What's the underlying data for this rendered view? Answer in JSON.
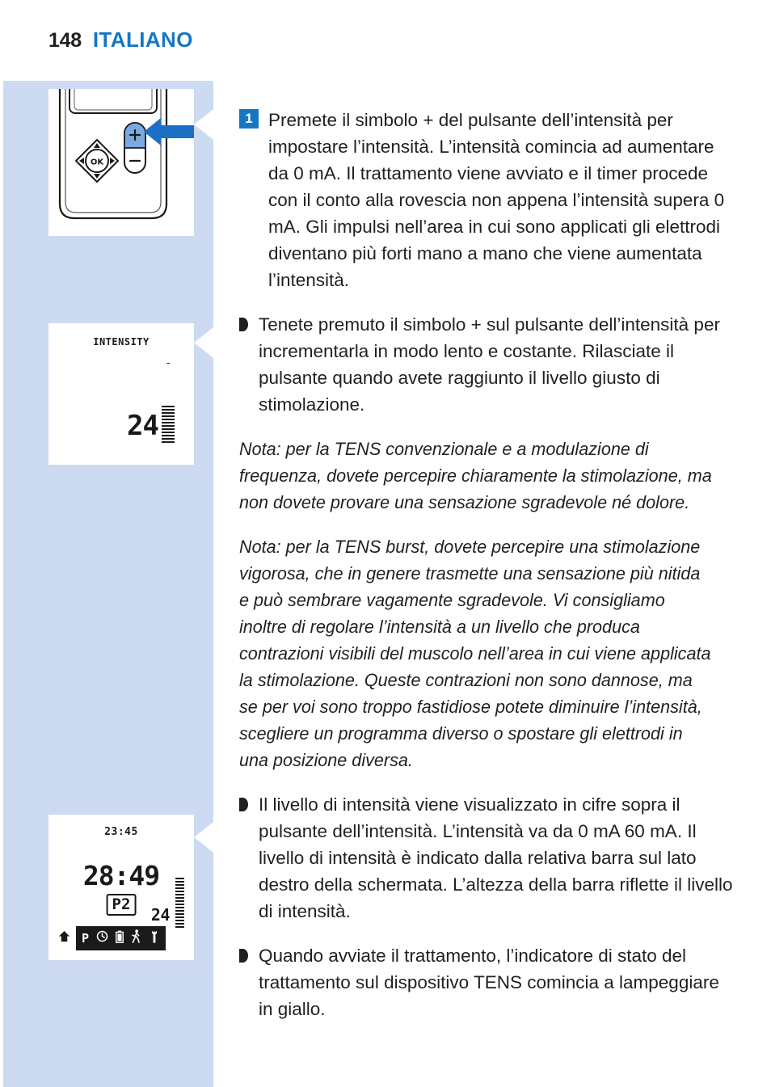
{
  "header": {
    "page_number": "148",
    "chapter": "ITALIANO"
  },
  "colors": {
    "accent_blue": "#1577c4",
    "panel_blue": "#ccdaf2",
    "text": "#231f20"
  },
  "illustrations": {
    "device": {
      "caption_ref": "1",
      "plus_label": "+",
      "minus_label": "−",
      "ok_label": "OK"
    },
    "lcd_intensity": {
      "label": "INTENSITY",
      "minus_mark": "-",
      "value": "24"
    },
    "lcd_treatment": {
      "clock": "23:45",
      "timer": "28:49",
      "program": "P2",
      "intensity": "24",
      "icons": [
        "home-icon",
        "program-icon",
        "clock-icon",
        "battery-icon",
        "walking-icon",
        "wrench-icon"
      ],
      "program_icon_label": "P"
    }
  },
  "content": {
    "step1": {
      "number": "1",
      "text": "Premete il simbolo + del pulsante dell’intensità per impostare l’intensità. L’intensità comincia ad aumentare da 0 mA. Il trattamento viene avviato e il timer procede con il conto alla rovescia non appena l’intensità supera 0 mA. Gli impulsi nell’area in cui sono applicati gli elettrodi diventano più forti mano a mano che viene aumentata l’intensità."
    },
    "bullet1": "Tenete premuto il simbolo + sul pulsante dell’intensità per incrementarla in modo lento e costante. Rilasciate il pulsante quando avete raggiunto il livello giusto di stimolazione.",
    "note1": "Nota: per la TENS convenzionale e a modulazione di frequenza, dovete percepire chiaramente la stimolazione, ma non dovete provare una sensazione sgradevole né dolore.",
    "note2": "Nota: per la TENS burst, dovete percepire una stimolazione vigorosa, che in genere trasmette una sensazione più nitida e può sembrare vagamente sgradevole. Vi consigliamo inoltre di regolare l’intensità a un livello che produca contrazioni visibili del muscolo nell’area in cui viene applicata la stimolazione. Queste contrazioni non sono dannose, ma se per voi sono troppo fastidiose potete diminuire l’intensità, scegliere un programma diverso o spostare gli elettrodi in una posizione diversa.",
    "bullet2": "Il livello di intensità viene visualizzato in cifre sopra il pulsante dell’intensità. L’intensità va da 0 mA 60 mA. Il livello di intensità è indicato dalla relativa barra sul lato destro della schermata. L’altezza della barra riflette il livello di intensità.",
    "bullet3": "Quando avviate il trattamento, l’indicatore di stato del trattamento sul dispositivo TENS comincia a lampeggiare in giallo."
  }
}
